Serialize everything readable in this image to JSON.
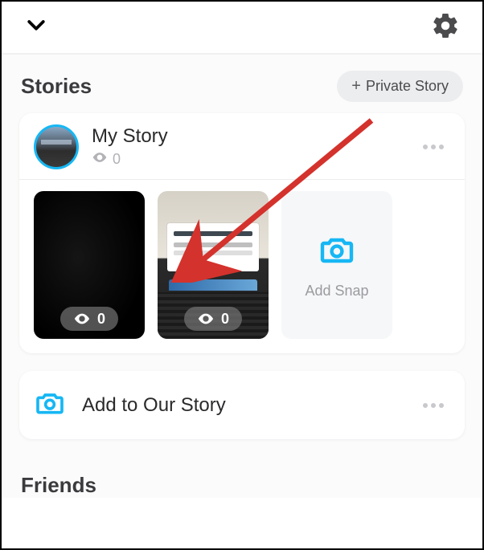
{
  "topbar": {
    "back_icon": "chevron-down",
    "settings_icon": "gear"
  },
  "sections": {
    "stories": {
      "title": "Stories",
      "private_button": "Private Story",
      "my_story": {
        "title": "My Story",
        "view_count": "0",
        "thumbs": [
          {
            "view_count": "0"
          },
          {
            "view_count": "0"
          }
        ],
        "add_snap_label": "Add Snap"
      },
      "our_story": {
        "label": "Add to Our Story"
      }
    },
    "friends": {
      "title": "Friends"
    }
  },
  "colors": {
    "accent": "#16b7f4",
    "text": "#3b3b3e",
    "muted": "#9b9ba0"
  }
}
